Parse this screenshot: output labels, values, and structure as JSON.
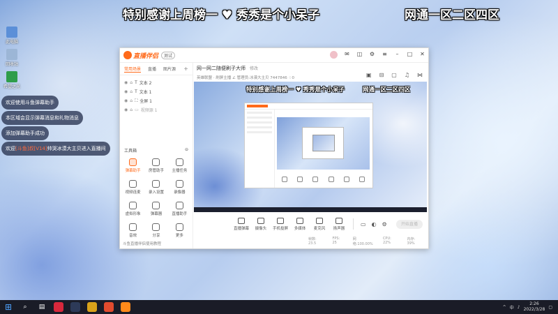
{
  "overlay": {
    "thanks_banner": "特别感谢上周榜一 ♥ 秀秀是个小呆子",
    "region_banner": "网通一区二区四区"
  },
  "desktop": {
    "icons": [
      {
        "label": "此电脑",
        "color": "#5b8fd8"
      },
      {
        "label": "回收站",
        "color": "#9cb6d6"
      },
      {
        "label": "希望之光",
        "color": "#2f9d4a"
      },
      {
        "label": "直播伴侣",
        "color": "#2b3b66"
      }
    ]
  },
  "chat": {
    "messages": [
      "欢迎使用斗鱼弹幕助手",
      "本区域会显示弹幕消息和礼物消息",
      "添加弹幕助手成功"
    ],
    "welcome": {
      "prefix": "欢迎",
      "highlight": "[斗鱼]叔[V14]",
      "suffix": "帅哭冰漠大主贝进入直播间"
    }
  },
  "app": {
    "brand": "直播伴侣",
    "version": "测试",
    "left_tabs": [
      "常用场景",
      "直播",
      "图片源"
    ],
    "add_tab": "+",
    "sources": [
      {
        "name": "文本 2",
        "dim": false
      },
      {
        "name": "文本 1",
        "dim": false
      },
      {
        "name": "全屏 1",
        "dim": false
      },
      {
        "name": "视频源 1",
        "dim": true
      }
    ],
    "tools_title": "工具箱",
    "tools": [
      {
        "label": "弹幕助手",
        "on": true
      },
      {
        "label": "房管助手",
        "on": false
      },
      {
        "label": "主播任务",
        "on": false
      },
      {
        "label": "视频连麦",
        "on": false
      },
      {
        "label": "录入设置",
        "on": false
      },
      {
        "label": "录像器",
        "on": false
      },
      {
        "label": "虚拟形象",
        "on": false
      },
      {
        "label": "弹幕器",
        "on": false
      },
      {
        "label": "直播助手",
        "on": false
      },
      {
        "label": "音效",
        "on": false
      },
      {
        "label": "分享",
        "on": false
      },
      {
        "label": "更多",
        "on": false
      }
    ],
    "left_footer": "斗鱼直播伴侣使用教程",
    "room_title": "网一网二随便刷子大师",
    "room_tag": "修改",
    "room_sub": "英雄联盟 · 刷屏主播 ∠ 管理员:冰漠大主贝  7447846  ♢0",
    "preview": {
      "thanks_banner": "特别感谢上周榜一 ♥ 秀秀是个小呆子",
      "region_banner": "网通一区二区四区"
    },
    "bottom_tools": [
      "直播弹幕",
      "摄像头",
      "手机投屏",
      "多媒体",
      "麦克风",
      "扬声器"
    ],
    "live_button": "开始直播",
    "status": [
      "帧数: 23.5",
      "FPS: 25",
      "网络:100.00%",
      "CPU: 22%",
      "内存: 39%"
    ]
  },
  "taskbar": {
    "time": "2:26",
    "date": "2022/3/28",
    "tray": [
      "^",
      "中",
      "♪"
    ]
  }
}
